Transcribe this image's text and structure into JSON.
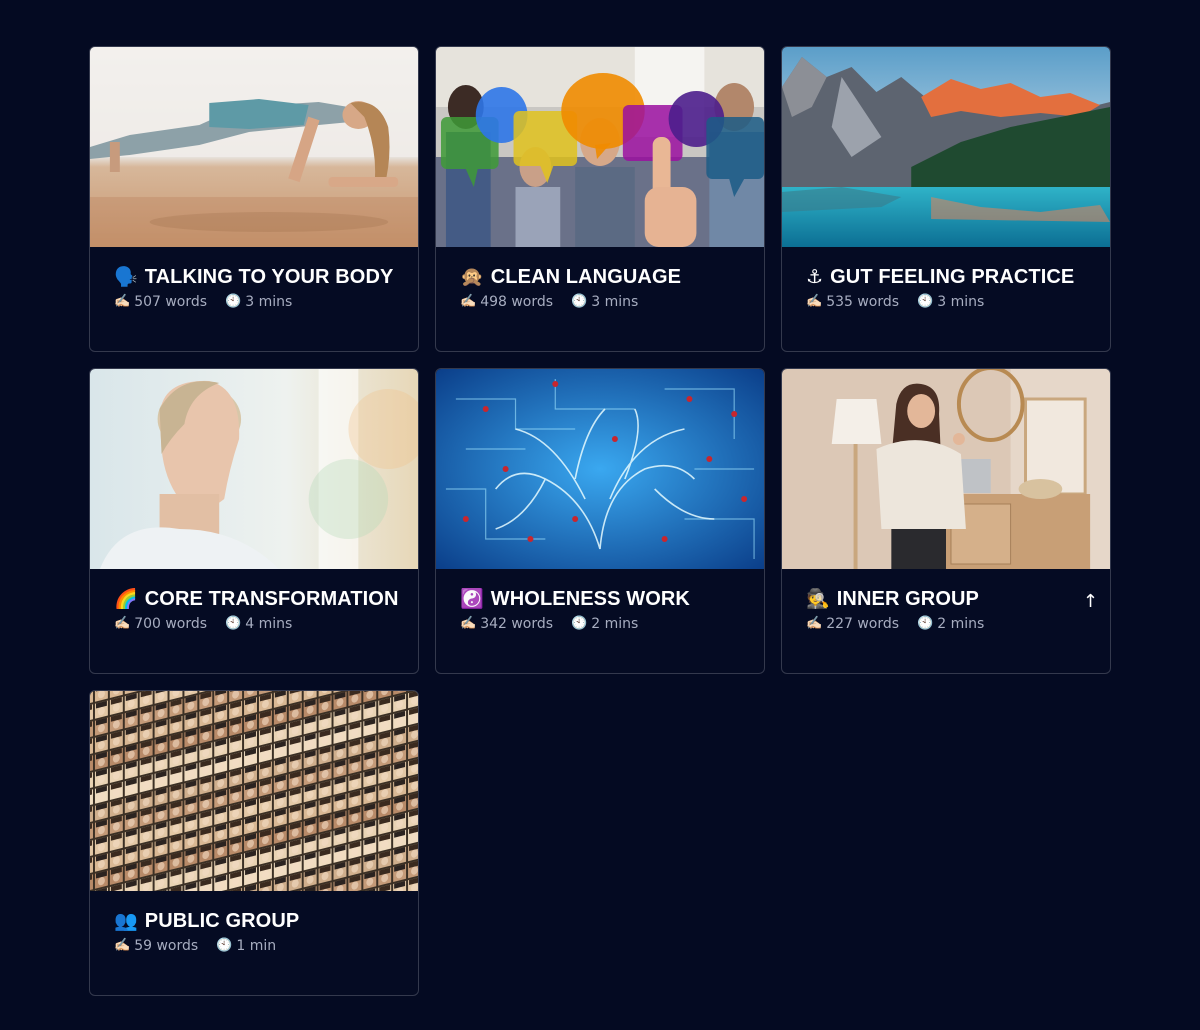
{
  "cards": [
    {
      "emoji": "🗣️",
      "title": "TALKING TO YOUR BODY",
      "write_icon": "✍🏻",
      "words": "507 words",
      "clock_icon": "🕙",
      "time": "3 mins",
      "image": "woman-plank-exercise"
    },
    {
      "emoji": "🙊",
      "title": "CLEAN LANGUAGE",
      "write_icon": "✍🏻",
      "words": "498 words",
      "clock_icon": "🕙",
      "time": "3 mins",
      "image": "speech-bubbles-group"
    },
    {
      "emoji": "⚓",
      "title": "GUT FEELING PRACTICE",
      "write_icon": "✍🏻",
      "words": "535 words",
      "clock_icon": "🕙",
      "time": "3 mins",
      "image": "mountain-lake"
    },
    {
      "emoji": "🌈",
      "title": "CORE TRANSFORMATION",
      "write_icon": "✍🏻",
      "words": "700 words",
      "clock_icon": "🕙",
      "time": "4 mins",
      "image": "meditating-woman"
    },
    {
      "emoji": "☯️",
      "title": "WHOLENESS WORK",
      "write_icon": "✍🏻",
      "words": "342 words",
      "clock_icon": "🕙",
      "time": "2 mins",
      "image": "neural-brain"
    },
    {
      "emoji": "🕵️",
      "title": "INNER GROUP",
      "write_icon": "✍🏻",
      "words": "227 words",
      "clock_icon": "🕙",
      "time": "2 mins",
      "image": "woman-talking-room"
    },
    {
      "emoji": "👥",
      "title": "PUBLIC GROUP",
      "write_icon": "✍🏻",
      "words": "59 words",
      "clock_icon": "🕙",
      "time": "1 min",
      "image": "faces-collage"
    }
  ],
  "scroll_top": {
    "label": "↑",
    "icon": "arrow-up-icon"
  },
  "colors": {
    "background": "#040a22",
    "card_border": "#34394d",
    "title": "#ffffff",
    "meta": "#a7adc0"
  }
}
